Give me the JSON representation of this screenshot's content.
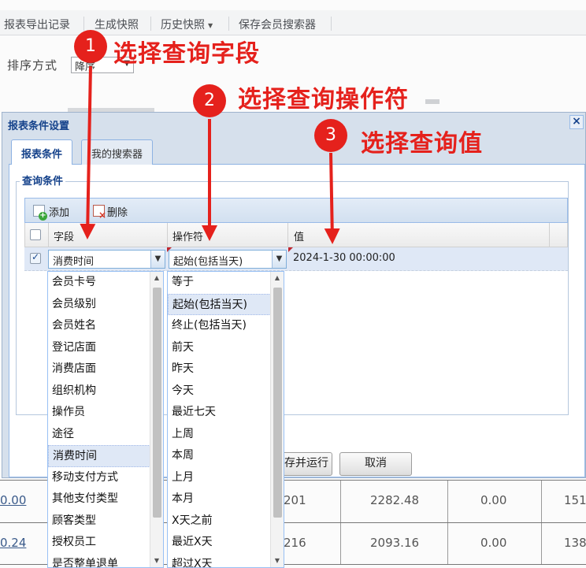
{
  "topbar": {
    "items": [
      "报表导出记录",
      "生成快照",
      "历史快照",
      "保存会员搜索器"
    ]
  },
  "sort": {
    "label": "排序方式",
    "value": "降序"
  },
  "background_rows": [
    {
      "first": "0.00",
      "c2": "201",
      "c3": "2282.48",
      "c4": "0.00",
      "c5": "151"
    },
    {
      "first": "0.24",
      "c2": "216",
      "c3": "2093.16",
      "c4": "0.00",
      "c5": "138"
    }
  ],
  "dialog": {
    "title": "报表条件设置",
    "tabs": [
      {
        "label": "报表条件",
        "active": true
      },
      {
        "label": "我的搜索器",
        "active": false
      }
    ],
    "fieldset_legend": "查询条件",
    "toolbar": {
      "add_label": "添加",
      "delete_label": "删除"
    },
    "columns": [
      "字段",
      "操作符",
      "值"
    ],
    "row": {
      "checked": true,
      "field": "消费时间",
      "operator": "起始(包括当天)",
      "value": "2024-1-30 00:00:00"
    },
    "buttons": {
      "save_run": "保存并运行",
      "cancel": "取消"
    }
  },
  "field_dropdown": {
    "items": [
      "会员卡号",
      "会员级别",
      "会员姓名",
      "登记店面",
      "消费店面",
      "组织机构",
      "操作员",
      "途径",
      "消费时间",
      "移动支付方式",
      "其他支付类型",
      "顾客类型",
      "授权员工",
      "是否整单退单"
    ],
    "selected": "消费时间"
  },
  "operator_dropdown": {
    "items": [
      "等于",
      "起始(包括当天)",
      "终止(包括当天)",
      "前天",
      "昨天",
      "今天",
      "最近七天",
      "上周",
      "本周",
      "上月",
      "本月",
      "X天之前",
      "最近X天",
      "超过X天"
    ],
    "selected": "起始(包括当天)"
  },
  "annotations": [
    {
      "number": "1",
      "text": "选择查询字段"
    },
    {
      "number": "2",
      "text": "选择查询操作符"
    },
    {
      "number": "3",
      "text": "选择查询值"
    }
  ],
  "colors": {
    "annotation_red": "#e5211c",
    "ext_blue": "#15428b",
    "selection": "#dfe8f6"
  }
}
